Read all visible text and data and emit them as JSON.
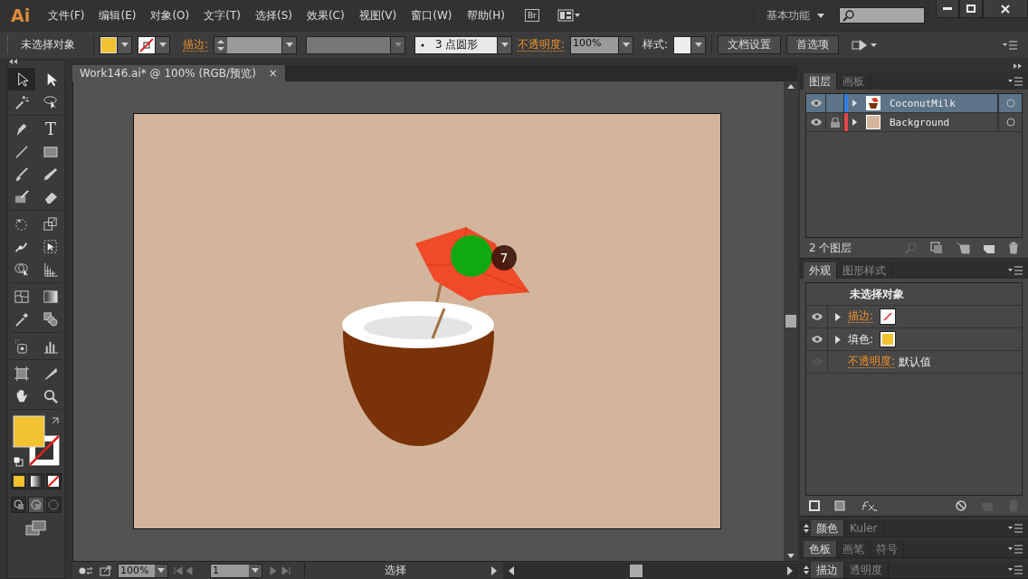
{
  "app_logo": "Ai",
  "menu": [
    "文件(F)",
    "编辑(E)",
    "对象(O)",
    "文字(T)",
    "选择(S)",
    "效果(C)",
    "视图(V)",
    "窗口(W)",
    "帮助(H)"
  ],
  "app_bar": {
    "bridge": "Br",
    "workspace": "基本功能"
  },
  "control_bar": {
    "selection": "未选择对象",
    "stroke_label": "描边:",
    "brush": "3 点圆形",
    "opacity_label": "不透明度:",
    "opacity": "100%",
    "style_label": "样式:",
    "buttons": [
      "文档设置",
      "首选项"
    ]
  },
  "toolbox": {
    "type_glyph": "T"
  },
  "document_tab": {
    "title": "Work146.ai* @ 100% (RGB/预览)",
    "close": "×"
  },
  "canvas": {
    "badge": "7"
  },
  "layers_panel": {
    "tabs": [
      {
        "label": "图层",
        "selected": true
      },
      {
        "label": "画板",
        "selected": false
      }
    ],
    "layers": [
      {
        "name": "CoconutMilk",
        "color": "#2f7fe8",
        "locked": false,
        "selected": true
      },
      {
        "name": "Background",
        "color": "#e04848",
        "locked": true,
        "selected": false
      }
    ],
    "count": "2 个图层"
  },
  "appearance_panel": {
    "tabs": [
      {
        "label": "外观",
        "selected": true
      },
      {
        "label": "图形样式",
        "selected": false
      }
    ],
    "title": "未选择对象",
    "rows": [
      {
        "kind": "stroke",
        "label": "描边:",
        "visible": true
      },
      {
        "kind": "fill",
        "label": "填色:",
        "visible": true
      },
      {
        "kind": "opacity",
        "label": "不透明度:",
        "value": "默认值",
        "visible": false
      }
    ]
  },
  "collapsed_panels": [
    {
      "tabs": [
        {
          "label": "颜色",
          "selected": true
        },
        {
          "label": "Kuler",
          "selected": false
        }
      ]
    },
    {
      "tabs": [
        {
          "label": "色板",
          "selected": true
        },
        {
          "label": "画笔",
          "selected": false
        },
        {
          "label": "符号",
          "selected": false
        }
      ]
    },
    {
      "tabs": [
        {
          "label": "描边",
          "selected": true
        },
        {
          "label": "透明度",
          "selected": false
        }
      ]
    }
  ],
  "status_bar": {
    "zoom": "100%",
    "artboard": "1",
    "tool": "选择"
  }
}
